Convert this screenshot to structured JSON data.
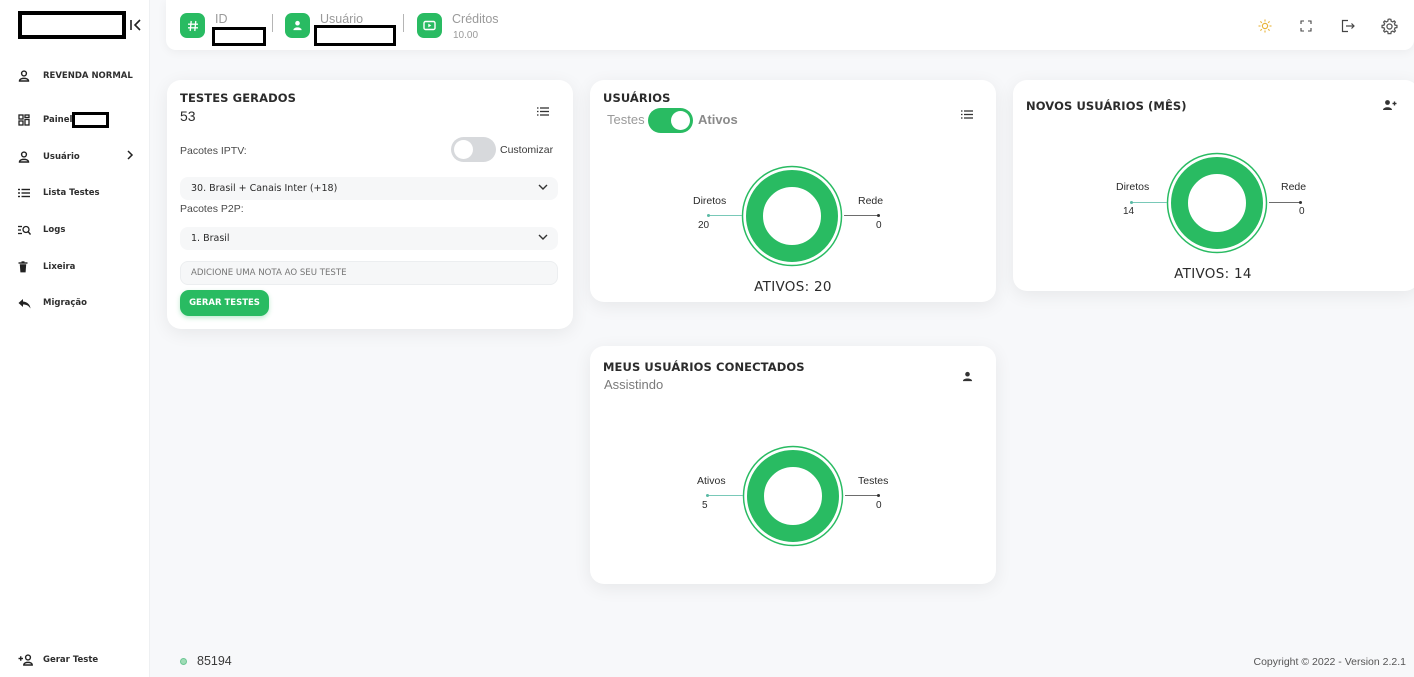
{
  "colors": {
    "accent": "#29bb62",
    "donut_ring": "#29bb62"
  },
  "sidebar": {
    "user_type": "REVENDA NORMAL",
    "items": [
      {
        "label": "Painel",
        "icon": "dashboard-icon"
      },
      {
        "label": "Usuário",
        "icon": "user-icon"
      },
      {
        "label": "Lista Testes",
        "icon": "list-icon"
      },
      {
        "label": "Logs",
        "icon": "search-list-icon"
      },
      {
        "label": "Lixeira",
        "icon": "trash-icon"
      },
      {
        "label": "Migração",
        "icon": "reply-icon"
      }
    ],
    "bottom_item": {
      "label": "Gerar Teste",
      "icon": "add-user-icon"
    }
  },
  "topbar": {
    "id_label": "ID",
    "user_label": "Usuário",
    "credits_label": "Créditos",
    "credits_value": "10.00"
  },
  "tests_card": {
    "title": "TESTES GERADOS",
    "count": "53",
    "iptv_label": "Pacotes IPTV:",
    "customize_label": "Customizar",
    "iptv_selected": "30. Brasil + Canais Inter (+18)",
    "p2p_label": "Pacotes P2P:",
    "p2p_selected": "1. Brasil",
    "note_placeholder": "ADICIONE UMA NOTA AO SEU TESTE",
    "generate_button": "GERAR TESTES"
  },
  "users_card": {
    "title": "USUÁRIOS",
    "toggle_left": "Testes",
    "toggle_right": "Ativos",
    "left_label": "Diretos",
    "left_value": "20",
    "right_label": "Rede",
    "right_value": "0",
    "total": "ATIVOS: 20"
  },
  "new_users_card": {
    "title": "NOVOS USUÁRIOS (MÊS)",
    "left_label": "Diretos",
    "left_value": "14",
    "right_label": "Rede",
    "right_value": "0",
    "total": "ATIVOS: 14"
  },
  "connected_card": {
    "title": "MEUS USUÁRIOS CONECTADOS",
    "subtitle": "Assistindo",
    "left_label": "Ativos",
    "left_value": "5",
    "right_label": "Testes",
    "right_value": "0"
  },
  "footer": {
    "status_number": "85194",
    "copyright": "Copyright © 2022 - Version 2.2.1"
  }
}
